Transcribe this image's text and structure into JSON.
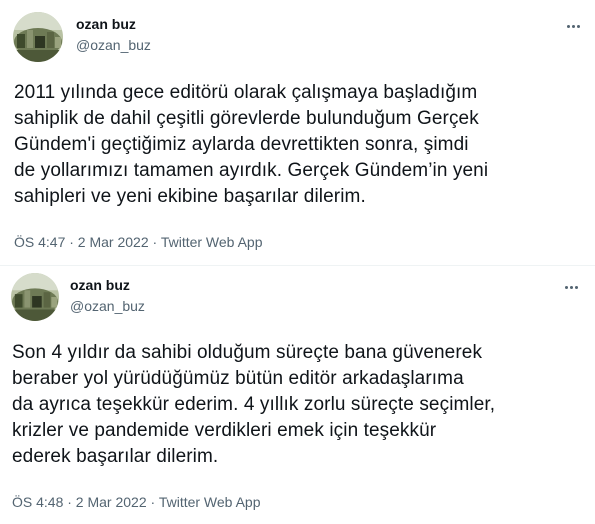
{
  "tweets": [
    {
      "author": {
        "name": "ozan buz",
        "handle": "@ozan_buz"
      },
      "text_lines": [
        "2011 yılında gece editörü olarak çalışmaya başladığım",
        "sahiplik de dahil çeşitli görevlerde bulunduğum Gerçek",
        "Gündem'i geçtiğimiz aylarda devrettikten sonra, şimdi",
        "de yollarımızı tamamen ayırdık. Gerçek Gündem’in yeni",
        "sahipleri ve yeni ekibine başarılar dilerim."
      ],
      "meta": "ÖS 4:47 · 2 Mar 2022 · Twitter Web App",
      "more_icon": "more-horizontal-icon"
    },
    {
      "author": {
        "name": "ozan buz",
        "handle": "@ozan_buz"
      },
      "text_lines": [
        "Son 4 yıldır da sahibi olduğum süreçte bana güvenerek",
        "beraber yol yürüdüğümüz bütün editör arkadaşlarıma",
        "da ayrıca teşekkür ederim. 4 yıllık zorlu süreçte seçimler,",
        "krizler ve pandemide verdikleri emek için teşekkür",
        "ederek başarılar dilerim."
      ],
      "meta": "ÖS 4:48 · 2 Mar 2022 · Twitter Web App",
      "more_icon": "more-horizontal-icon"
    }
  ],
  "colors": {
    "text_primary": "#0f1419",
    "text_secondary": "#536471",
    "divider": "#eff3f4",
    "background": "#ffffff"
  }
}
